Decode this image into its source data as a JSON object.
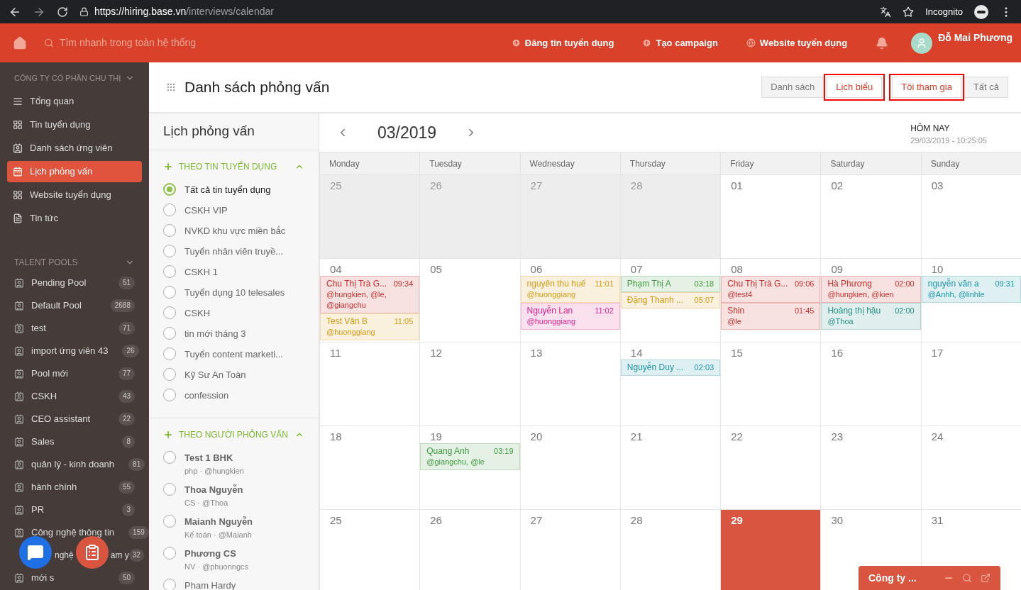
{
  "browser": {
    "url_host": "https://hiring.base.vn",
    "url_path": "/interviews/calendar",
    "profile": "Incognito"
  },
  "header": {
    "search_placeholder": "Tìm nhanh trong toàn hệ thống",
    "links": [
      "Đăng tin tuyển dụng",
      "Tạo campaign",
      "Website tuyển dụng"
    ],
    "user": "Đỗ Mai Phương"
  },
  "sidebar": {
    "company": "CÔNG TY CỔ PHẦN CHU THỊ",
    "nav": [
      {
        "label": "Tổng quan",
        "selected": false
      },
      {
        "label": "Tin tuyển dụng",
        "selected": false
      },
      {
        "label": "Danh sách ứng viên",
        "selected": false
      },
      {
        "label": "Lịch phỏng vấn",
        "selected": true
      },
      {
        "label": "Website tuyển dụng",
        "selected": false
      },
      {
        "label": "Tin tức",
        "selected": false
      }
    ],
    "pools_title": "TALENT POOLS",
    "pools": [
      {
        "label": "Pending Pool",
        "count": "51"
      },
      {
        "label": "Default Pool",
        "count": "2688"
      },
      {
        "label": "test",
        "count": "71"
      },
      {
        "label": "import ứng viên 43",
        "count": "26"
      },
      {
        "label": "Pool mới",
        "count": "77"
      },
      {
        "label": "CSKH",
        "count": "43"
      },
      {
        "label": "CEO assistant",
        "count": "22"
      },
      {
        "label": "Sales",
        "count": "8"
      },
      {
        "label": "quản lý - kinh doanh",
        "count": "81"
      },
      {
        "label": "hành chính",
        "count": "55"
      },
      {
        "label": "PR",
        "count": "3"
      },
      {
        "label": "Công nghệ thông tin",
        "count": "159"
      },
      {
        "fragments": [
          "nghệ",
          "am y"
        ],
        "count": "32"
      },
      {
        "label": "mới s",
        "count": "50"
      }
    ]
  },
  "page": {
    "title": "Danh sách phỏng vấn",
    "view_tabs": [
      {
        "label": "Danh sách",
        "selected": false
      },
      {
        "label": "Lịch biểu",
        "selected": true
      }
    ],
    "filter_tabs": [
      {
        "label": "Tôi tham gia",
        "selected": true
      },
      {
        "label": "Tất cả",
        "selected": false
      }
    ]
  },
  "filters": {
    "title": "Lịch phỏng vấn",
    "sections": [
      {
        "title": "THEO TIN TUYỂN DỤNG",
        "expanded": true,
        "items": [
          {
            "label": "Tất cả tin tuyển dụng",
            "selected": true
          },
          {
            "label": "CSKH VIP",
            "selected": false
          },
          {
            "label": "NVKD khu vực miền bắc",
            "selected": false
          },
          {
            "label": "Tuyển nhân viên truyề...",
            "selected": false
          },
          {
            "label": "CSKH 1",
            "selected": false
          },
          {
            "label": "Tuyển dụng 10 telesales",
            "selected": false
          },
          {
            "label": "CSKH",
            "selected": false
          },
          {
            "label": "tin mới tháng 3",
            "selected": false
          },
          {
            "label": "Tuyển content marketi...",
            "selected": false
          },
          {
            "label": "Kỹ Sư An Toàn",
            "selected": false
          },
          {
            "label": "confession",
            "selected": false
          }
        ]
      },
      {
        "title": "THEO NGƯỜI PHỎNG VẤN",
        "expanded": true,
        "items": [
          {
            "label": "Test 1 BHK",
            "sub": "php · @hungkien",
            "selected": false
          },
          {
            "label": "Thoa Nguyễn",
            "sub": "CS · @Thoa",
            "selected": false
          },
          {
            "label": "Maianh Nguyễn",
            "sub": "Kế toán · @Maianh",
            "selected": false
          },
          {
            "label": "Phương CS",
            "sub": "NV · @phuonngcs",
            "selected": false
          },
          {
            "label": "Pham Hardy",
            "selected": false
          }
        ]
      }
    ]
  },
  "calendar": {
    "month": "03/2019",
    "today_label": "HÔM NAY",
    "today_time": "29/03/2019 - 10:25:05",
    "weekdays": [
      "Monday",
      "Tuesday",
      "Wednesday",
      "Thursday",
      "Friday",
      "Saturday",
      "Sunday"
    ],
    "weeks": [
      [
        {
          "day": "25",
          "muted": true,
          "today": false
        },
        {
          "day": "26",
          "muted": true,
          "today": false
        },
        {
          "day": "27",
          "muted": true,
          "today": false
        },
        {
          "day": "28",
          "muted": true,
          "today": false
        },
        {
          "day": "01",
          "muted": false,
          "today": false
        },
        {
          "day": "02",
          "muted": false,
          "today": false
        },
        {
          "day": "03",
          "muted": false,
          "today": false
        }
      ],
      [
        {
          "day": "04",
          "muted": false,
          "today": false,
          "events": [
            {
              "name": "Chu Thị Trà G...",
              "time": "09:34",
              "people": "@hungkien, @le, @giangchu",
              "color": "#c9302c"
            },
            {
              "name": "Test Văn B",
              "time": "11:05",
              "people": "@huonggiang",
              "color": "#d49a12"
            }
          ]
        },
        {
          "day": "05",
          "muted": false,
          "today": false
        },
        {
          "day": "06",
          "muted": false,
          "today": false,
          "events": [
            {
              "name": "nguyên thu huế",
              "time": "11:01",
              "people": "@huonggiang",
              "color": "#d49a12"
            },
            {
              "name": "Nguyễn Lan",
              "time": "11:02",
              "people": "@huonggiang",
              "color": "#e0218a"
            }
          ]
        },
        {
          "day": "07",
          "muted": false,
          "today": false,
          "events": [
            {
              "name": "Phạm Thị A",
              "time": "03:18",
              "color": "#3f9a3f"
            },
            {
              "name": "Đặng Thanh ...",
              "time": "05:07",
              "color": "#d49a12"
            }
          ]
        },
        {
          "day": "08",
          "muted": false,
          "today": false,
          "events": [
            {
              "name": "Chu Thị Trà G...",
              "time": "09:06",
              "people": "@test4",
              "color": "#c9302c"
            },
            {
              "name": "Shin",
              "time": "01:45",
              "people": "@le",
              "color": "#c9302c"
            }
          ]
        },
        {
          "day": "09",
          "muted": false,
          "today": false,
          "events": [
            {
              "name": "Hà Phương",
              "time": "02:00",
              "people": "@hungkien, @kien",
              "color": "#c9302c"
            },
            {
              "name": "Hoàng thị hậu",
              "time": "02:00",
              "people": "@Thoa",
              "color": "#238f86"
            }
          ]
        },
        {
          "day": "10",
          "muted": false,
          "today": false,
          "events": [
            {
              "name": "nguyễn văn a",
              "time": "09:31",
              "people": "@Anhh, @linhle",
              "color": "#1b93a8"
            }
          ]
        }
      ],
      [
        {
          "day": "11",
          "muted": false,
          "today": false
        },
        {
          "day": "12",
          "muted": false,
          "today": false
        },
        {
          "day": "13",
          "muted": false,
          "today": false
        },
        {
          "day": "14",
          "muted": false,
          "today": false,
          "events": [
            {
              "name": "Nguyễn Duy ...",
              "time": "02:03",
              "color": "#1b93a8"
            }
          ]
        },
        {
          "day": "15",
          "muted": false,
          "today": false
        },
        {
          "day": "16",
          "muted": false,
          "today": false
        },
        {
          "day": "17",
          "muted": false,
          "today": false
        }
      ],
      [
        {
          "day": "18",
          "muted": false,
          "today": false
        },
        {
          "day": "19",
          "muted": false,
          "today": false,
          "events": [
            {
              "name": "Quang Anh",
              "time": "03:19",
              "people": "@giangchu, @le",
              "color": "#3f9a3f"
            }
          ]
        },
        {
          "day": "20",
          "muted": false,
          "today": false
        },
        {
          "day": "21",
          "muted": false,
          "today": false
        },
        {
          "day": "22",
          "muted": false,
          "today": false
        },
        {
          "day": "23",
          "muted": false,
          "today": false
        },
        {
          "day": "24",
          "muted": false,
          "today": false
        }
      ],
      [
        {
          "day": "25",
          "muted": false,
          "today": false
        },
        {
          "day": "26",
          "muted": false,
          "today": false
        },
        {
          "day": "27",
          "muted": false,
          "today": false
        },
        {
          "day": "28",
          "muted": false,
          "today": false
        },
        {
          "day": "29",
          "muted": false,
          "today": true
        },
        {
          "day": "30",
          "muted": false,
          "today": false
        },
        {
          "day": "31",
          "muted": false,
          "today": false
        }
      ]
    ]
  },
  "chat_widget": {
    "title": "Công ty ..."
  }
}
